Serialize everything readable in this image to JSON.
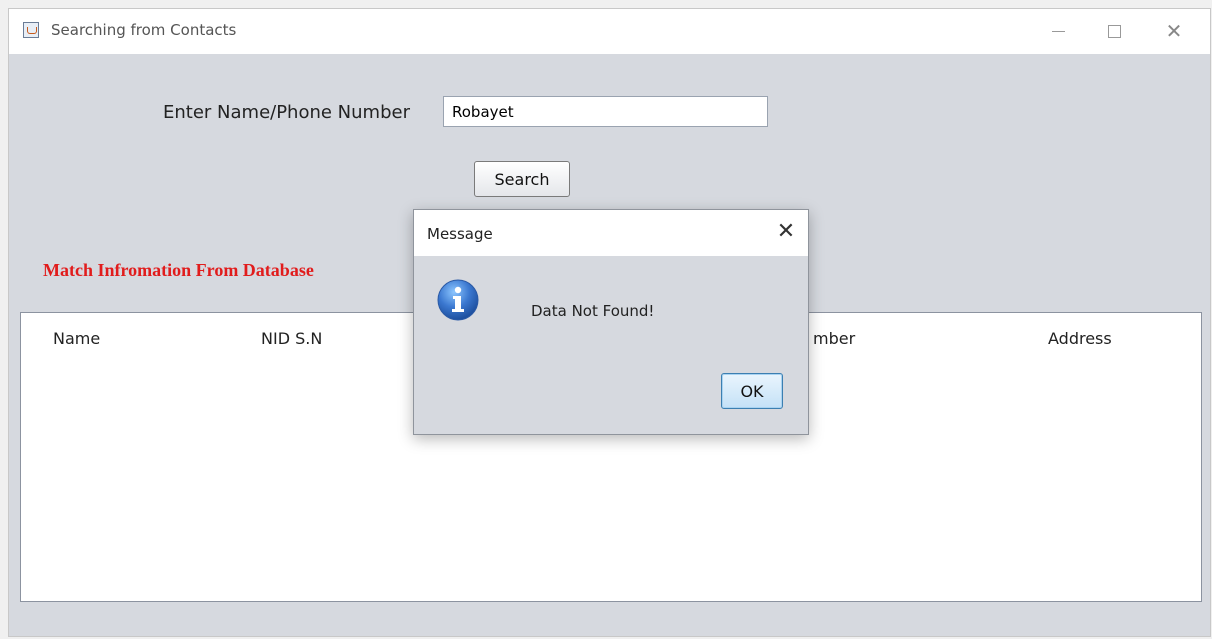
{
  "window": {
    "title": "Searching from Contacts",
    "icon": "java-cup-icon"
  },
  "window_controls": {
    "minimize": "minimize-icon",
    "maximize": "maximize-icon",
    "close": "close-icon"
  },
  "search": {
    "label": "Enter Name/Phone Number",
    "value": "Robayet",
    "button_label": "Search"
  },
  "results": {
    "section_title": "Match Infromation From Database",
    "section_title_color": "#e11c1c",
    "columns": [
      "Name",
      "NID S.N",
      "mber",
      "Address"
    ],
    "rows": []
  },
  "dialog": {
    "title": "Message",
    "icon": "info-icon",
    "message": "Data Not Found!",
    "ok_label": "OK",
    "close_icon": "close-icon"
  }
}
